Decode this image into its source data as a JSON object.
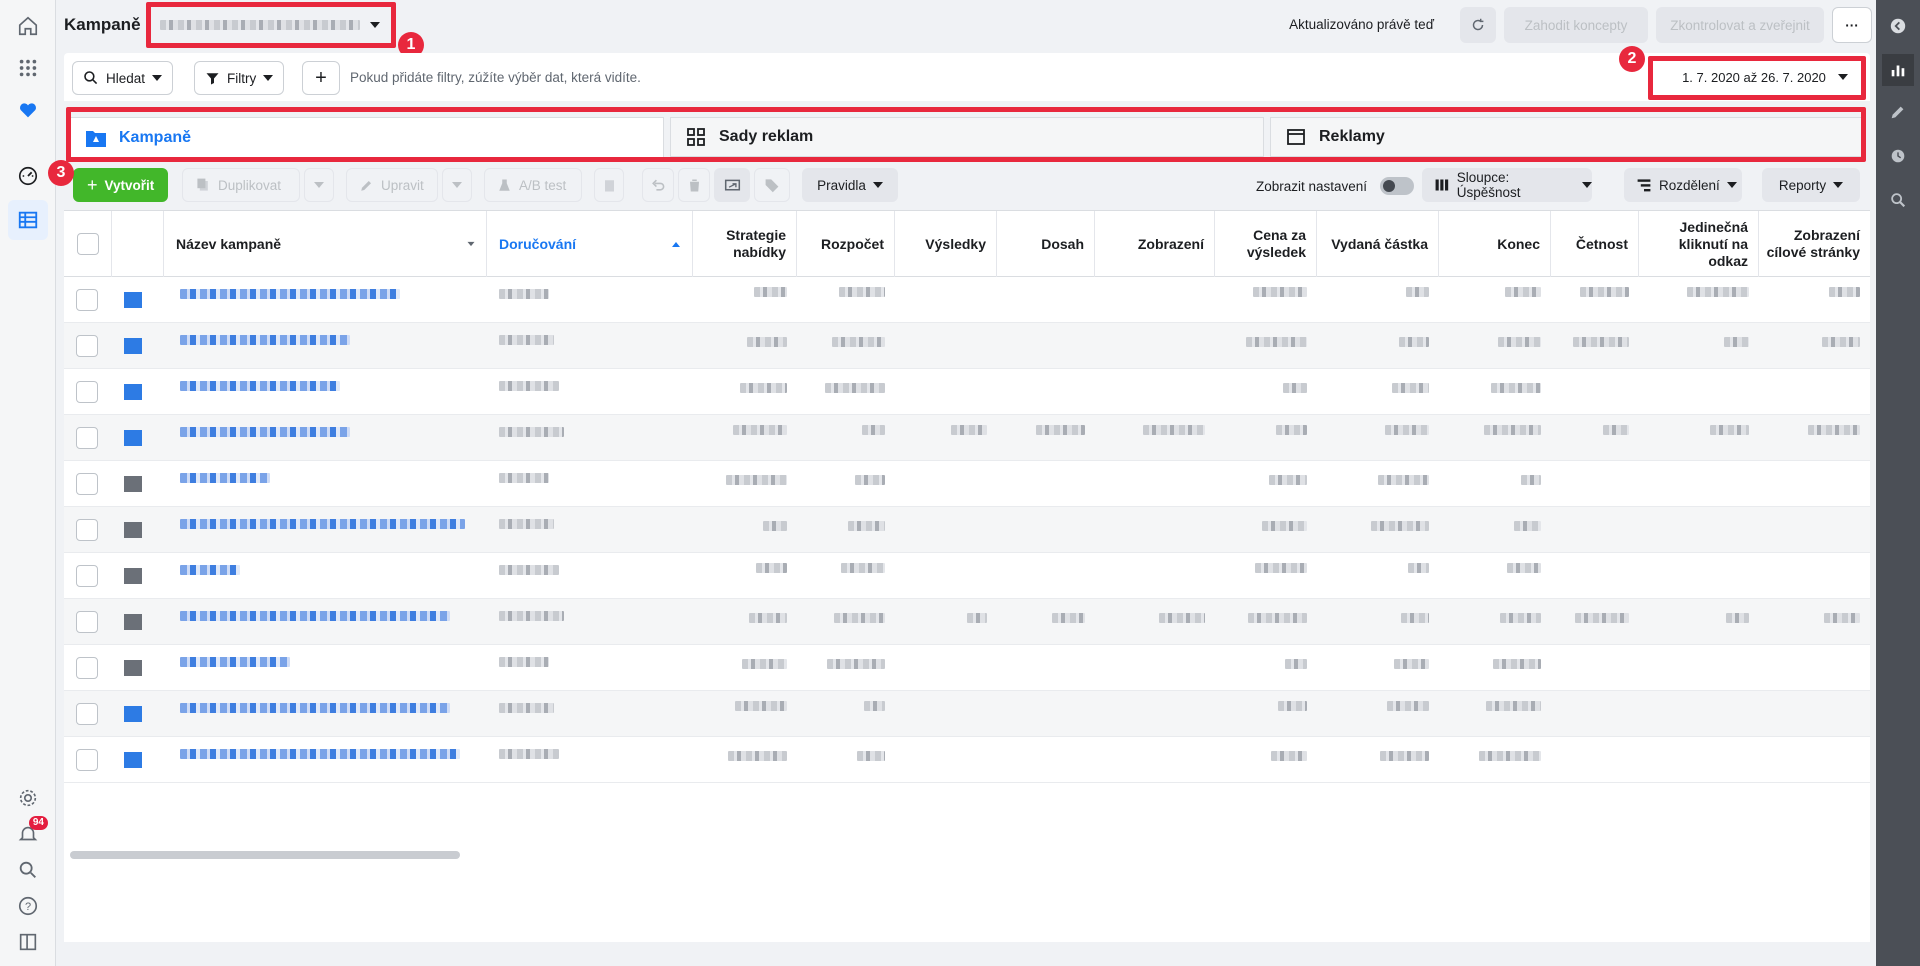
{
  "app": {
    "title": "Kampaně"
  },
  "left_nav": {
    "icons": [
      "home-icon",
      "apps-grid-icon",
      "heart-icon",
      "dashboard-gauge-icon",
      "table-icon",
      "settings-icon",
      "notifications-icon",
      "search-icon",
      "help-icon",
      "sidebar-toggle-icon"
    ],
    "notification_count": "94"
  },
  "right_bar": {
    "icons": [
      "collapse-icon",
      "chart-icon",
      "edit-icon",
      "clock-icon",
      "search-zoom-icon"
    ]
  },
  "header": {
    "updated": "Aktualizováno právě teď",
    "discard": "Zahodit koncepty",
    "review": "Zkontrolovat a zveřejnit",
    "more": "···"
  },
  "filters": {
    "search": "Hledat",
    "filters": "Filtry",
    "add": "+",
    "hint": "Pokud přidáte filtry, zúžíte výběr dat, která vidíte.",
    "date_range": "1. 7. 2020 až 26. 7. 2020"
  },
  "annotations": {
    "one": "1",
    "two": "2",
    "three": "3",
    "color": "#e8283d"
  },
  "tabs": [
    {
      "label": "Kampaně"
    },
    {
      "label": "Sady reklam"
    },
    {
      "label": "Reklamy"
    }
  ],
  "toolbar": {
    "create": "Vytvořit",
    "duplicate": "Duplikovat",
    "edit": "Upravit",
    "ab_test": "A/B test",
    "rules": "Pravidla",
    "show_settings": "Zobrazit nastavení",
    "columns": "Sloupce: Úspěšnost",
    "breakdown": "Rozdělení",
    "reports": "Reporty"
  },
  "table": {
    "columns": [
      "Název kampaně",
      "Doručování",
      "Strategie nabídky",
      "Rozpočet",
      "Výsledky",
      "Dosah",
      "Zobrazení",
      "Cena za výsledek",
      "Vydaná částka",
      "Konec",
      "Četnost",
      "Jedinečná kliknutí na odkaz",
      "Zobrazení cílové stránky"
    ],
    "sorted_column": "Doručování",
    "row_count": 11
  },
  "colors": {
    "accent": "#1877f2",
    "create_green": "#42b72a",
    "highlight_red": "#e8283d"
  }
}
